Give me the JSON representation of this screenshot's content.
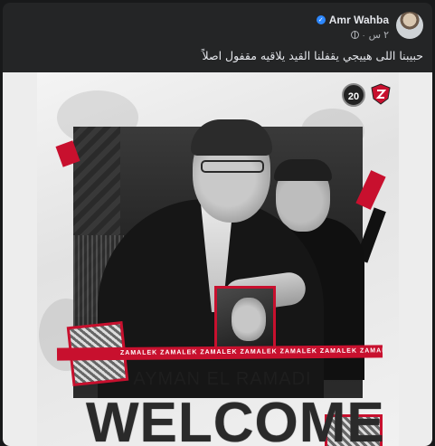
{
  "post": {
    "author": "Amr Wahba",
    "time": "٢ س",
    "text": "حبيبنا اللى هييجي يقفلنا القيد يلاقيه مقفول اصلاً"
  },
  "poster": {
    "badge_number": "20",
    "ribbon_text": "ZAMALEK ZAMALEK ZAMALEK ZAMALEK ZAMALEK ZAMALEK ZAMALEK ZAMALEK",
    "subtitle": "AYMAN EL RAMADI",
    "headline": "WELCOME"
  },
  "icons": {
    "verified": "verified-badge-icon",
    "privacy": "globe-icon",
    "club_logo": "zamalek-crest-icon",
    "anniversary": "20-anniversary-badge-icon"
  },
  "colors": {
    "card_bg": "#242526",
    "text_primary": "#e4e6eb",
    "text_secondary": "#b0b3b8",
    "verified_blue": "#2d88ff",
    "club_red": "#c8102e"
  }
}
